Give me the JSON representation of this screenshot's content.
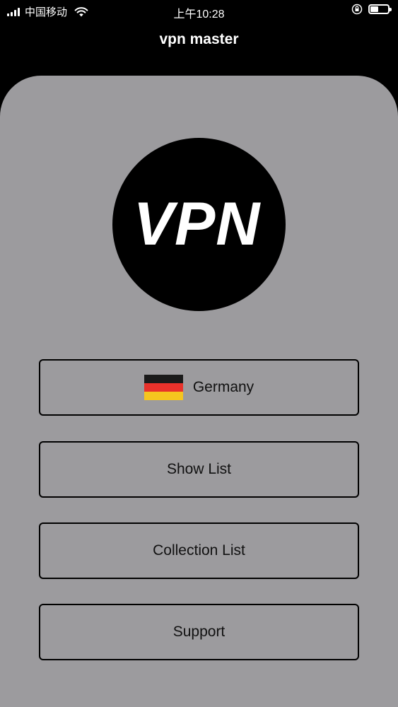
{
  "status_bar": {
    "carrier": "中国移动",
    "time": "上午10:28"
  },
  "nav": {
    "title": "vpn master"
  },
  "logo": {
    "text": "VPN"
  },
  "buttons": {
    "country": "Germany",
    "show_list": "Show List",
    "collection_list": "Collection List",
    "support": "Support"
  },
  "flag_colors": [
    "#1a1a1a",
    "#e8322b",
    "#f5c51f"
  ],
  "colors": {
    "background": "#000000",
    "card": "#9c9b9e"
  },
  "battery_level": 0.45
}
